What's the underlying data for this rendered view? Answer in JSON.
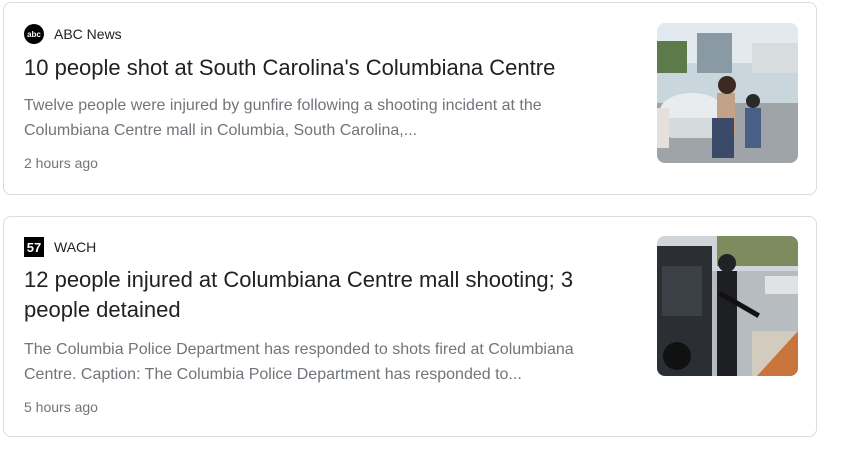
{
  "results": [
    {
      "source": "ABC News",
      "source_icon": "abc-news-logo-icon",
      "headline": "10 people shot at South Carolina's Columbiana Centre",
      "snippet": "Twelve people were injured by gunfire following a shooting incident at the Columbiana Centre mall in Columbia, South Carolina,...",
      "time": "2 hours ago",
      "logo_text": "abc"
    },
    {
      "source": "WACH",
      "source_icon": "wach-57-logo-icon",
      "headline": "12 people injured at Columbiana Centre mall shooting; 3 people detained",
      "snippet": "The Columbia Police Department has responded to shots fired at Columbiana Centre. Caption: The Columbia Police Department has responded to...",
      "time": "5 hours ago",
      "logo_text": "57"
    }
  ],
  "colors": {
    "headline": "#202124",
    "meta": "#70757a",
    "border": "#dadce0"
  }
}
